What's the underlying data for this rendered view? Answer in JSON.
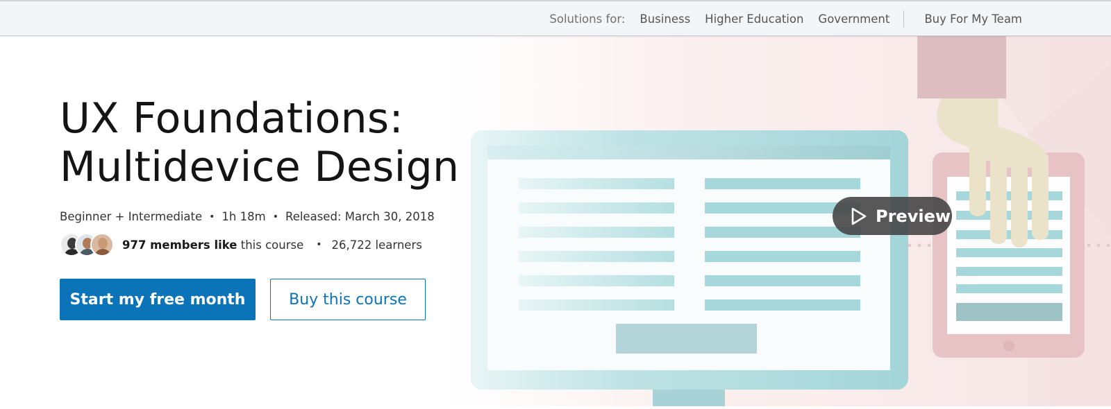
{
  "topbar": {
    "solutions_label": "Solutions for:",
    "links": [
      "Business",
      "Higher Education",
      "Government"
    ],
    "team_link": "Buy For My Team"
  },
  "course": {
    "title": "UX Foundations: Multidevice Design",
    "level": "Beginner + Intermediate",
    "duration": "1h 18m",
    "released": "Released: March 30, 2018",
    "members_bold": "977 members like",
    "members_rest": " this course",
    "learners": "26,722 learners"
  },
  "actions": {
    "primary_label": "Start my free month",
    "secondary_label": "Buy this course"
  },
  "preview": {
    "label": "Preview",
    "icon": "play-icon"
  },
  "colors": {
    "brand_blue": "#0b73b7",
    "topbar_bg": "#f3f6f8",
    "monitor_teal": "#a6d7da",
    "tablet_pink": "#e9c3c6",
    "hand_beige": "#eae0c8"
  }
}
